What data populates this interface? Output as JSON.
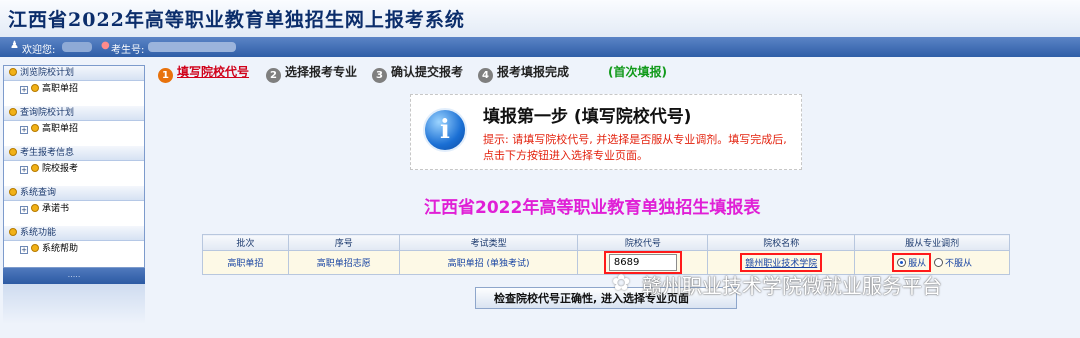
{
  "header": {
    "title": "江西省2022年高等职业教育单独招生网上报考系统"
  },
  "userbar": {
    "welcome": "欢迎您:",
    "exam_no_label": "考生号:"
  },
  "sidebar": {
    "sections": [
      {
        "title": "浏览院校计划",
        "items": [
          "高职单招"
        ]
      },
      {
        "title": "查询院校计划",
        "items": [
          "高职单招"
        ]
      },
      {
        "title": "考生报考信息",
        "items": [
          "院校报考"
        ]
      },
      {
        "title": "系统查询",
        "items": [
          "承诺书"
        ]
      },
      {
        "title": "系统功能",
        "items": [
          "系统帮助"
        ]
      }
    ],
    "footer": "....."
  },
  "steps": [
    {
      "num": "1",
      "label": "填写院校代号",
      "active": true
    },
    {
      "num": "2",
      "label": "选择报考专业",
      "active": false
    },
    {
      "num": "3",
      "label": "确认提交报考",
      "active": false
    },
    {
      "num": "4",
      "label": "报考填报完成",
      "active": false
    }
  ],
  "first_fill_note": "(首次填报)",
  "info": {
    "icon": "info-icon",
    "title": "填报第一步 (填写院校代号)",
    "hint": "提示: 请填写院校代号, 并选择是否服从专业调剂。填写完成后, 点击下方按钮进入选择专业页面。"
  },
  "form_title": "江西省2022年高等职业教育单独招生填报表",
  "table": {
    "headers": [
      "批次",
      "序号",
      "考试类型",
      "院校代号",
      "院校名称",
      "服从专业调剂"
    ],
    "row": {
      "batch": "高职单招",
      "order": "高职单招志愿",
      "exam_type": "高职单招 (单独考试)",
      "school_code": "8689",
      "school_name": "赣州职业技术学院",
      "obey_label": "服从",
      "not_obey_label": "不服从",
      "obey_selected": true
    }
  },
  "check_button": "检查院校代号正确性, 进入选择专业页面",
  "watermark": "赣州职业技术学院微就业服务平台",
  "colors": {
    "accent_red": "#ff1a1a",
    "form_title": "#e01fd6",
    "first_fill": "#119a1a"
  }
}
